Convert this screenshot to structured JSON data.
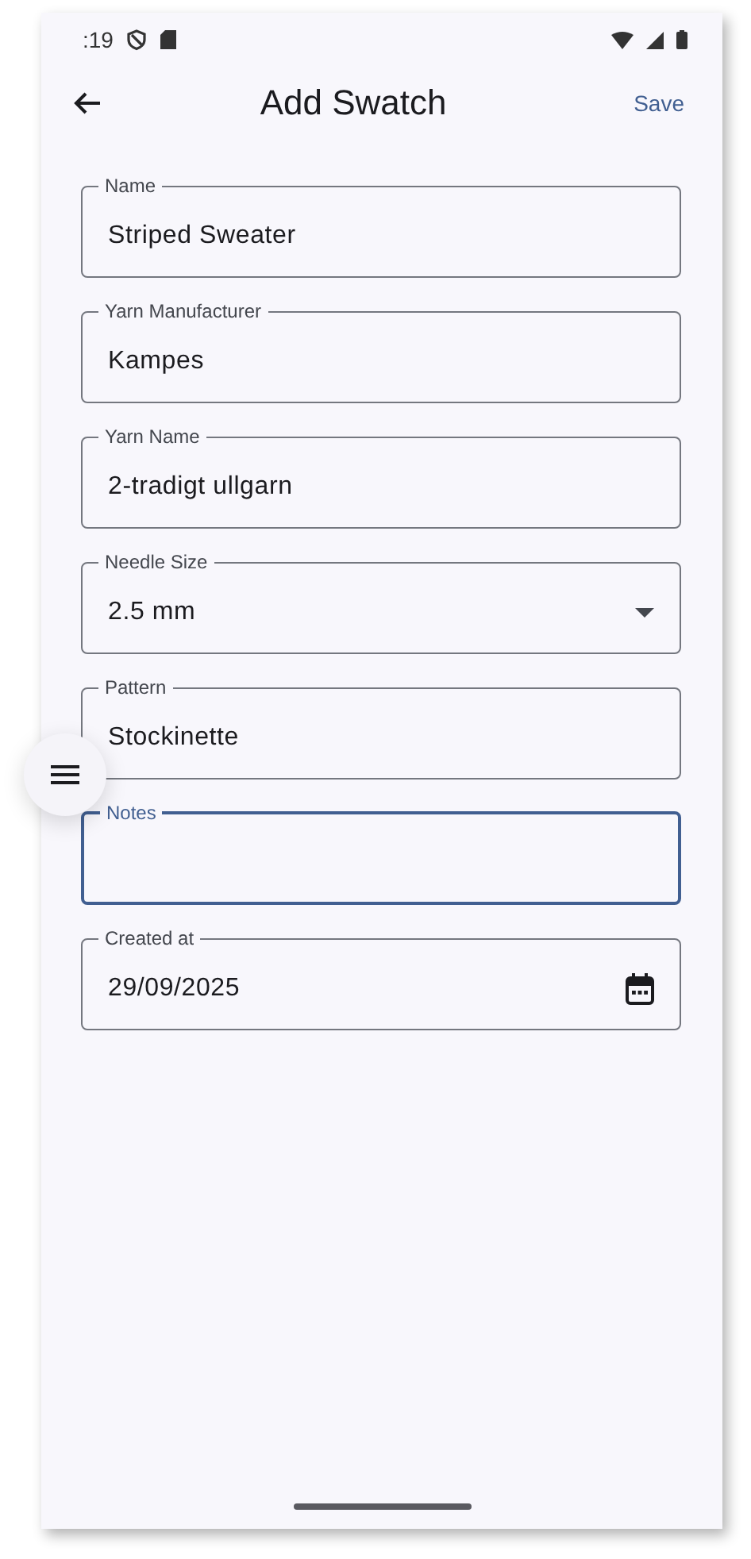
{
  "status_bar": {
    "time": ":19"
  },
  "app_bar": {
    "title": "Add Swatch",
    "action": "Save"
  },
  "fields": [
    {
      "kind": "text",
      "label": "Name",
      "value": "Striped Sweater",
      "focused": false
    },
    {
      "kind": "text",
      "label": "Yarn Manufacturer",
      "value": "Kampes",
      "focused": false
    },
    {
      "kind": "text",
      "label": "Yarn Name",
      "value": "2-tradigt ullgarn",
      "focused": false
    },
    {
      "kind": "dropdown",
      "label": "Needle Size",
      "value": "2.5 mm",
      "focused": false
    },
    {
      "kind": "text",
      "label": "Pattern",
      "value": "Stockinette",
      "focused": false
    },
    {
      "kind": "text",
      "label": "Notes",
      "focused": true
    },
    {
      "kind": "date",
      "label": "Created at",
      "value": "29/09/2025",
      "focused": false
    }
  ]
}
